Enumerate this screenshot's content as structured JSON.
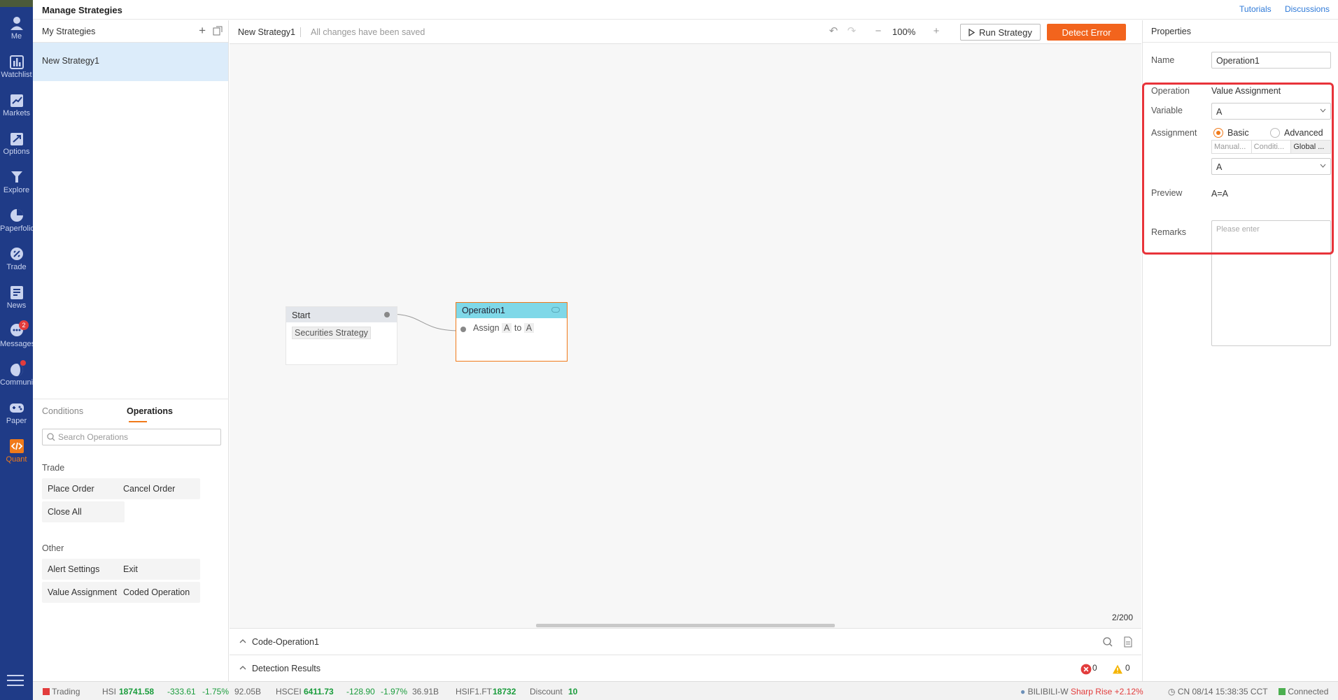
{
  "app": {
    "title": "Manage Strategies",
    "links": [
      "Tutorials",
      "Discussions"
    ]
  },
  "nav": [
    {
      "label": "Me",
      "icon": "user-icon"
    },
    {
      "label": "Watchlist",
      "icon": "bar-chart-icon"
    },
    {
      "label": "Markets",
      "icon": "trend-icon"
    },
    {
      "label": "Options",
      "icon": "options-icon"
    },
    {
      "label": "Explore",
      "icon": "telescope-icon"
    },
    {
      "label": "Paperfolio",
      "icon": "pie-icon"
    },
    {
      "label": "Trade",
      "icon": "trade-icon"
    },
    {
      "label": "News",
      "icon": "news-icon"
    },
    {
      "label": "Messages",
      "icon": "chat-icon",
      "badge": "2"
    },
    {
      "label": "Community",
      "icon": "community-icon"
    },
    {
      "label": "Paper",
      "icon": "gamepad-icon"
    },
    {
      "label": "Quant",
      "icon": "code-icon"
    }
  ],
  "left": {
    "header": "My Strategies",
    "strategies": [
      "New Strategy1"
    ],
    "tabs": [
      "Conditions",
      "Operations"
    ],
    "search_placeholder": "Search Operations",
    "groups": [
      {
        "title": "Trade",
        "items": [
          "Place Order",
          "Cancel Order",
          "Close All"
        ]
      },
      {
        "title": "Other",
        "items": [
          "Alert Settings",
          "Exit",
          "Value Assignment",
          "Coded Operation"
        ]
      }
    ]
  },
  "toolbar": {
    "strategy_name": "New Strategy1",
    "saved_status": "All changes have been saved",
    "zoom": "100%",
    "run_label": "Run Strategy",
    "detect_label": "Detect Error"
  },
  "canvas": {
    "start": {
      "title": "Start",
      "body": "Securities Strategy"
    },
    "operation": {
      "title": "Operation1",
      "assign": "Assign",
      "var": "A",
      "to": "to",
      "value": "A"
    },
    "counter": "2/200"
  },
  "bottom": {
    "code_title": "Code-Operation1",
    "results_title": "Detection Results",
    "error_count": "0",
    "warning_count": "0"
  },
  "props": {
    "header": "Properties",
    "name_label": "Name",
    "name_value": "Operation1",
    "operation_label": "Operation",
    "operation_value": "Value Assignment",
    "variable_label": "Variable",
    "variable_value": "A",
    "assignment_label": "Assignment",
    "radio_basic": "Basic",
    "radio_advanced": "Advanced",
    "segments": [
      "Manual...",
      "Conditi...",
      "Global ..."
    ],
    "value_select": "A",
    "preview_label": "Preview",
    "preview_value": "A=A",
    "remarks_label": "Remarks",
    "remarks_placeholder": "Please enter"
  },
  "status": {
    "trading": "Trading",
    "hsi_label": "HSI",
    "hsi_value": "18741.58",
    "hsi_change": "-333.61",
    "hsi_pct": "-1.75%",
    "hsi_turnover": "92.05B",
    "hscei_label": "HSCEI",
    "hscei_value": "6411.73",
    "hscei_change": "-128.90",
    "hscei_pct": "-1.97%",
    "hscei_turnover": "36.91B",
    "hsif_label": "HSIF1.FT",
    "hsif_value": "18732",
    "discount_label": "Discount",
    "discount_value": "10",
    "alert_symbol": "BILIBILI-W",
    "alert_text": "Sharp Rise +2.12%",
    "clock": "CN 08/14 15:38:35 CCT",
    "connection": "Connected"
  },
  "colors": {
    "accent": "#f2641d",
    "rail": "#1f3b87",
    "highlight_box": "#e8333a",
    "node_header": "#7fd8e8"
  }
}
